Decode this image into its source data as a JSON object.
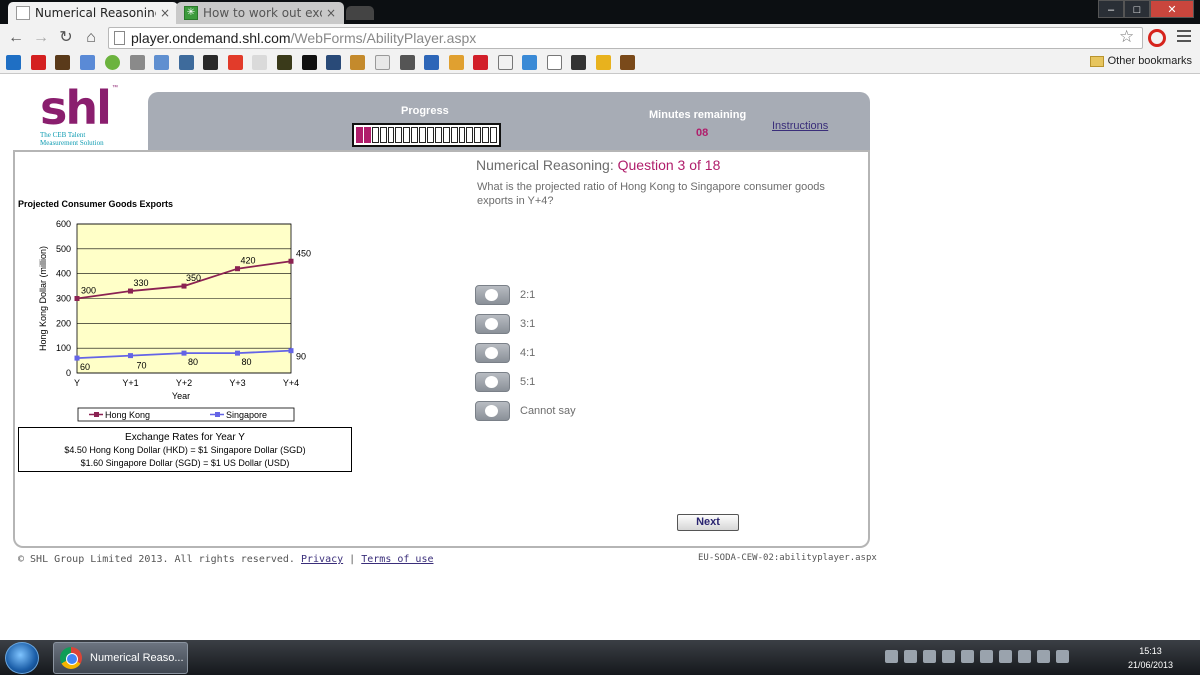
{
  "browser": {
    "tabs": [
      {
        "title": "Numerical Reasoning",
        "close": "×"
      },
      {
        "title": "How to work out exchang",
        "close": "×"
      }
    ],
    "url_host": "player.ondemand.shl.com",
    "url_path": "/WebForms/AbilityPlayer.aspx",
    "other_bookmarks": "Other bookmarks",
    "window_buttons": [
      "–",
      "□",
      "✕"
    ]
  },
  "header": {
    "logo_text": "shl",
    "logo_tm": "™",
    "logo_tagline_1": "The CEB Talent",
    "logo_tagline_2": "Measurement Solution",
    "progress_label": "Progress",
    "progress_fraction": 0.111,
    "progress_segments_total": 18,
    "progress_segments_done": 2,
    "minutes_label": "Minutes remaining",
    "minutes_value": "08",
    "instructions_link": "Instructions"
  },
  "question": {
    "section": "Numerical Reasoning:",
    "number": "Question 3 of 18",
    "text": "What is the projected ratio of Hong Kong to Singapore consumer goods exports in Y+4?",
    "options": [
      "2:1",
      "3:1",
      "4:1",
      "5:1",
      "Cannot say"
    ],
    "next_label": "Next"
  },
  "chart_data": {
    "type": "line",
    "title": "Projected Consumer Goods Exports",
    "xlabel": "Year",
    "ylabel": "Hong Kong Dollar (million)",
    "categories": [
      "Y",
      "Y+1",
      "Y+2",
      "Y+3",
      "Y+4"
    ],
    "ylim": [
      0,
      600
    ],
    "yticks": [
      0,
      100,
      200,
      300,
      400,
      500,
      600
    ],
    "grid": true,
    "legend_position": "bottom",
    "series": [
      {
        "name": "Hong Kong",
        "values": [
          300,
          330,
          350,
          420,
          450
        ],
        "color": "#8b2252"
      },
      {
        "name": "Singapore",
        "values": [
          60,
          70,
          80,
          80,
          90
        ],
        "color": "#6464e6"
      }
    ]
  },
  "exchange_rates": {
    "title": "Exchange Rates for Year Y",
    "line1": "$4.50 Hong Kong Dollar (HKD) = $1 Singapore Dollar (SGD)",
    "line2": "$1.60 Singapore Dollar (SGD) = $1 US Dollar (USD)"
  },
  "footer": {
    "copyright": "© SHL Group Limited 2013. All rights reserved.",
    "privacy": "Privacy",
    "separator": "|",
    "terms": "Terms of use",
    "server_id": "EU-SODA-CEW-02:abilityplayer.aspx"
  },
  "taskbar": {
    "task_label": "Numerical Reaso...",
    "time": "15:13",
    "date": "21/06/2013"
  },
  "colors": {
    "accent": "#b01d6b",
    "header_bar": "#a7acb5",
    "link": "#3a2e7a"
  }
}
